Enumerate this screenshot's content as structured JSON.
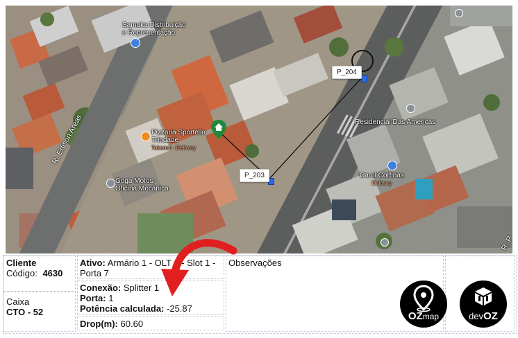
{
  "map": {
    "place_labels": {
      "samuka_1": "Samuka Distribuição",
      "samuka_2": "e Representação",
      "pizzaria_1": "Pizzaria Sportello",
      "pizzaria_2": "Trindade",
      "pizzaria_sub": "Takeout · Delivery",
      "goga_1": "Goga Motos-",
      "goga_2": "Oficina Mecânica",
      "residencial": "Residencial Das Américas",
      "carol_1": "Carol Cortinas",
      "carol_sub": "Delivery"
    },
    "road_labels": {
      "edison": "R. Edison Areas",
      "bottom_right": "R. P"
    },
    "points": [
      {
        "label": "P_204"
      },
      {
        "label": "P_203"
      }
    ],
    "icons": {
      "home_marker": "home-pin-icon",
      "shop": "shopping-bag-icon",
      "location": "location-pin-icon",
      "food": "food-icon",
      "flag": "flag-icon"
    }
  },
  "panel": {
    "cliente_label": "Cliente",
    "codigo_label": "Código:",
    "codigo_value": "4630",
    "caixa_label": "Caixa",
    "caixa_value": "CTO - 52",
    "ativo_label": "Ativo:",
    "ativo_value": "Armário 1 - OLT 1 - Slot 1 - Porta 7",
    "conexao_label": "Conexão:",
    "conexao_value": "Splitter 1",
    "porta_label": "Porta:",
    "porta_value": "1",
    "potencia_label": "Potência calculada:",
    "potencia_value": "-25.87",
    "drop_label": "Drop(m):",
    "drop_value": "60.60",
    "observacoes_label": "Observações"
  },
  "logos": {
    "ozmap_text_1": "OZ",
    "ozmap_text_2": "map",
    "devoz_text_1": "dev",
    "devoz_text_2": "OZ"
  },
  "colors": {
    "arrow": "#e02020",
    "marker_green": "#1f8a3c",
    "marker_blue": "#2a6ce8"
  }
}
